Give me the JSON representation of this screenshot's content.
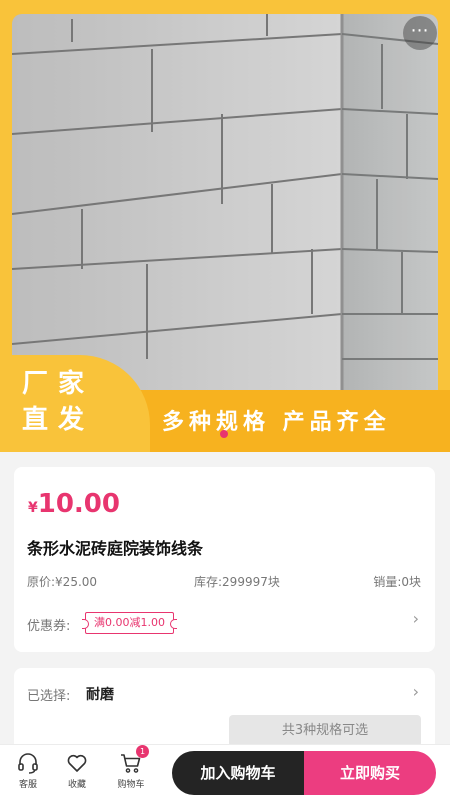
{
  "hero": {
    "icon_more": "more-dots-icon",
    "tag_text": "厂家直发",
    "slogan": "多种规格 产品齐全",
    "colors": {
      "band": "#f7b21f",
      "frame": "#f9c33a",
      "dot": "#e8356f"
    }
  },
  "product": {
    "currency": "¥",
    "price": "10.00",
    "title": "条形水泥砖庭院装饰线条",
    "original_price": "原价:¥25.00",
    "stock": "库存:299997块",
    "sales": "销量:0块",
    "coupon_label": "优惠券:",
    "coupon": "满0.00减1.00"
  },
  "spec": {
    "label": "已选择:",
    "value": "耐磨",
    "count_text": "共3种规格可选"
  },
  "bottom_bar": {
    "service_label": "客服",
    "favorite_label": "收藏",
    "cart_label": "购物车",
    "cart_badge": "1",
    "add_to_cart": "加入购物车",
    "buy_now": "立即购买",
    "colors": {
      "cart_btn": "#242424",
      "buy_btn": "#ec3d80"
    }
  },
  "icons": {
    "chevron": "›",
    "service": "headset-icon",
    "favorite": "heart-icon",
    "cart": "cart-icon"
  }
}
